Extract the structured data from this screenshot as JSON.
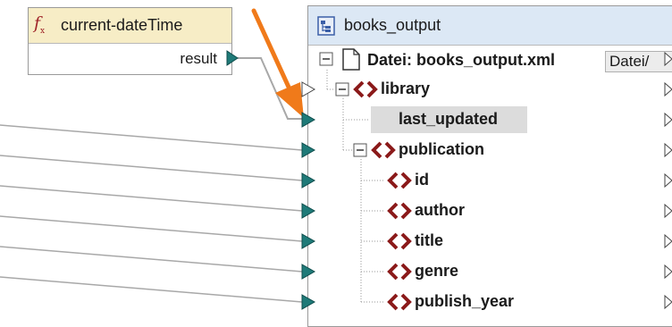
{
  "function_box": {
    "title": "current-dateTime",
    "output": "result"
  },
  "component": {
    "title": "books_output",
    "file_row": {
      "label": "Datei: books_output.xml",
      "button": "Datei/"
    },
    "nodes": [
      {
        "label": "library"
      },
      {
        "label": "last_updated",
        "selected": true
      },
      {
        "label": "publication"
      },
      {
        "label": "id"
      },
      {
        "label": "author"
      },
      {
        "label": "title"
      },
      {
        "label": "genre"
      },
      {
        "label": "publish_year"
      }
    ]
  },
  "colors": {
    "function_header": "#f7edc6",
    "component_header": "#dce8f5",
    "connector": "#1f7a78",
    "element_icon": "#8b1a1a",
    "arrow": "#f07a1a",
    "line": "#a8a8a8"
  }
}
